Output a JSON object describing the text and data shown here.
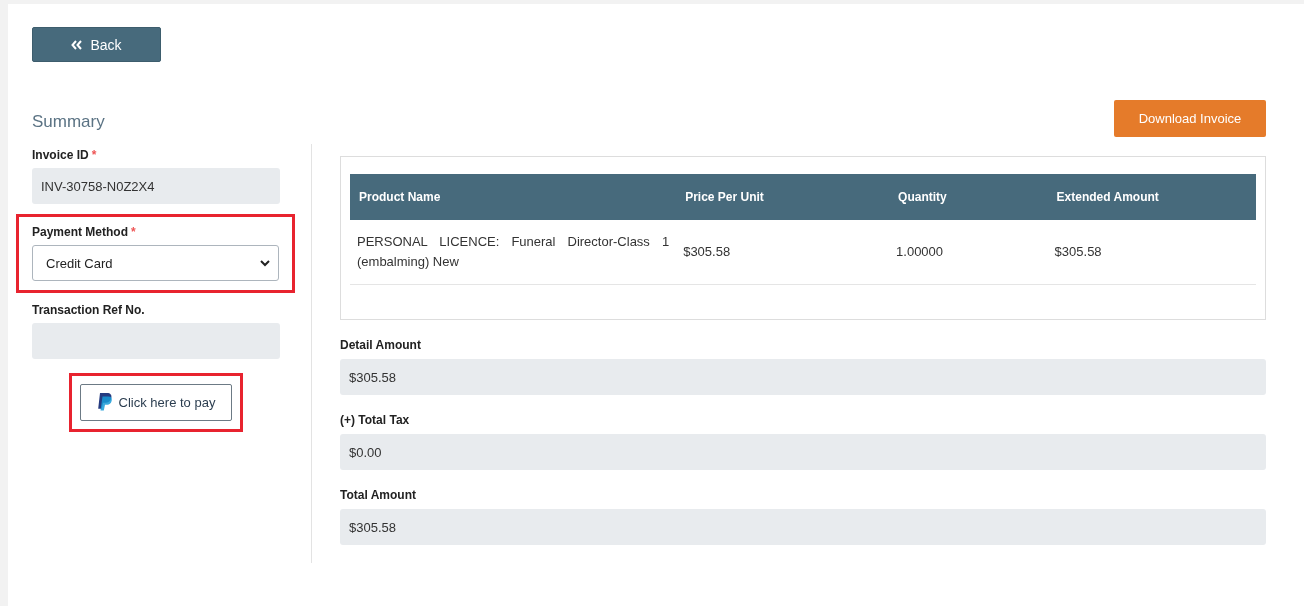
{
  "back_button": {
    "label": "Back"
  },
  "summary": {
    "title": "Summary",
    "fields": [
      {
        "kind": "text",
        "label": "Invoice ID",
        "required_mark": "*",
        "value": "INV-30758-N0Z2X4",
        "highlighted": false
      },
      {
        "kind": "select",
        "label": "Payment Method",
        "required_mark": "*",
        "value": "Credit Card",
        "highlighted": true
      },
      {
        "kind": "text",
        "label": "Transaction Ref No.",
        "highlighted": false
      }
    ],
    "pay_button": {
      "label": "Click here to pay",
      "highlighted": true
    }
  },
  "download_button": {
    "label": "Download Invoice"
  },
  "table": {
    "columns": [
      "Product Name",
      "Price Per Unit",
      "Quantity",
      "Extended Amount"
    ],
    "rows": [
      [
        "PERSONAL LICENCE: Funeral Director-Class 1 (embalming) New",
        "$305.58",
        "1.00000",
        "$305.58"
      ]
    ]
  },
  "totals": [
    {
      "label": "Detail Amount",
      "value": "$305.58"
    },
    {
      "label": "(+) Total Tax",
      "value": "$0.00"
    },
    {
      "label": "Total Amount",
      "value": "$305.58"
    }
  ]
}
